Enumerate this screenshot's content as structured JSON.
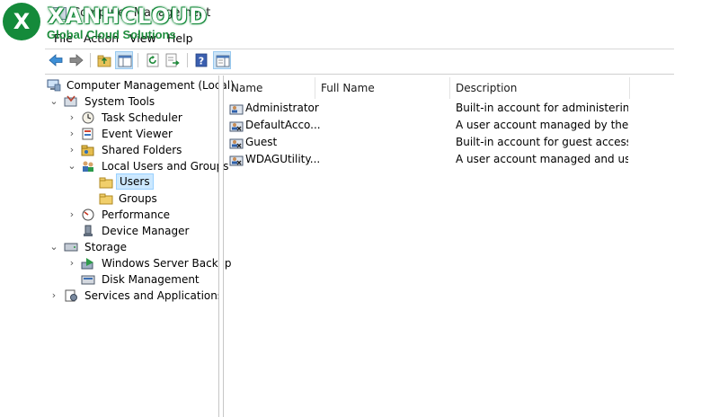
{
  "logo": {
    "mark": "X",
    "brand": "XANHCLOUD",
    "tagline": "Global Cloud Solutions"
  },
  "window": {
    "title": "Computer Management"
  },
  "menu": [
    "File",
    "Action",
    "View",
    "Help"
  ],
  "toolbar": {
    "icons": [
      "back-arrow-icon",
      "forward-arrow-icon",
      "up-folder-icon",
      "show-hide-tree-icon",
      "refresh-icon",
      "export-list-icon",
      "help-icon",
      "show-hide-action-pane-icon"
    ]
  },
  "tree": {
    "root": "Computer Management (Local)",
    "system_tools": "System Tools",
    "task_scheduler": "Task Scheduler",
    "event_viewer": "Event Viewer",
    "shared_folders": "Shared Folders",
    "local_users_groups": "Local Users and Groups",
    "users": "Users",
    "groups": "Groups",
    "performance": "Performance",
    "device_manager": "Device Manager",
    "storage": "Storage",
    "windows_server_backup": "Windows Server Backup",
    "disk_management": "Disk Management",
    "services_apps": "Services and Applications"
  },
  "list": {
    "columns": [
      "Name",
      "Full Name",
      "Description"
    ],
    "rows": [
      {
        "name": "Administrator",
        "full_name": "",
        "description": "Built-in account for administering..."
      },
      {
        "name": "DefaultAcco...",
        "full_name": "",
        "description": "A user account managed by the s..."
      },
      {
        "name": "Guest",
        "full_name": "",
        "description": "Built-in account for guest access t..."
      },
      {
        "name": "WDAGUtility...",
        "full_name": "",
        "description": "A user account managed and use..."
      }
    ]
  },
  "colors": {
    "brand_green": "#148a3a",
    "selection": "#cce8ff"
  }
}
